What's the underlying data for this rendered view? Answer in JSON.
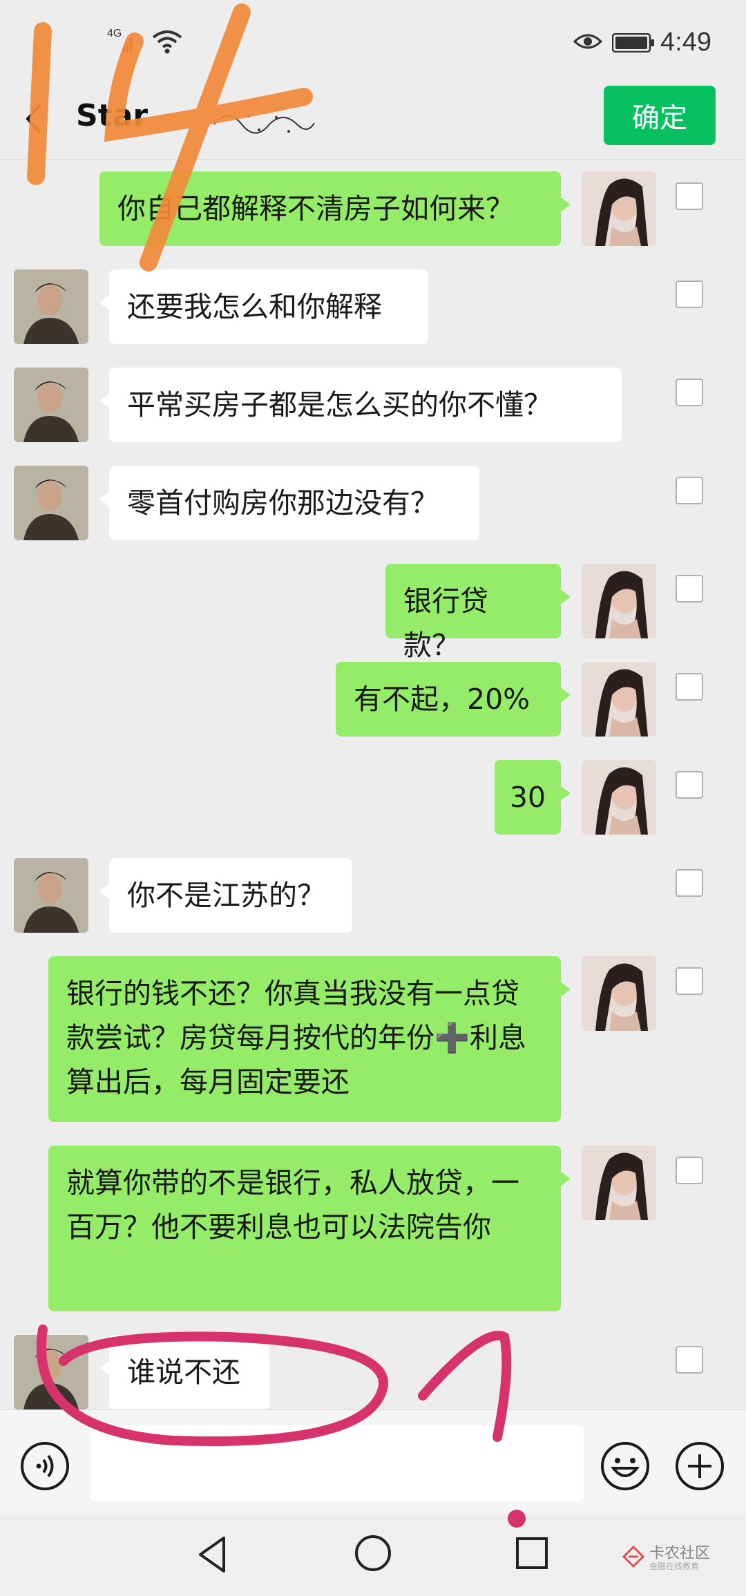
{
  "status_bar": {
    "network": "4G",
    "time": "4:49",
    "icons": [
      "signal-icon",
      "wifi-icon",
      "eye-icon",
      "battery-icon"
    ]
  },
  "header": {
    "title": "Star",
    "confirm_label": "确定",
    "back_icon": "chevron-left-icon"
  },
  "messages": [
    {
      "sender": "me",
      "text": "你自己都解释不清房子如何来？"
    },
    {
      "sender": "other",
      "text": "还要我怎么和你解释"
    },
    {
      "sender": "other",
      "text": "平常买房子都是怎么买的你不懂？"
    },
    {
      "sender": "other",
      "text": "零首付购房你那边没有？"
    },
    {
      "sender": "me",
      "text": "银行贷款？"
    },
    {
      "sender": "me",
      "text": "有不起，20%"
    },
    {
      "sender": "me",
      "text": "30"
    },
    {
      "sender": "other",
      "text": "你不是江苏的？"
    },
    {
      "sender": "me",
      "text": "银行的钱不还？你真当我没有一点贷款尝试？房贷每月按代的年份➕利息算出后，每月固定要还"
    },
    {
      "sender": "me",
      "text": "就算你带的不是银行，私人放贷，一百万？他不要利息也可以法院告你"
    },
    {
      "sender": "other",
      "text": "谁说不还"
    }
  ],
  "input_bar": {
    "value": "",
    "icons": [
      "voice-icon",
      "emoji-icon",
      "plus-icon"
    ]
  },
  "nav_bar": {
    "icons": [
      "nav-back-icon",
      "nav-home-icon",
      "nav-recent-icon"
    ]
  },
  "watermark": {
    "title": "卡农社区",
    "subtitle": "金融在线教育"
  },
  "annotations": {
    "number": "14",
    "colors": {
      "orange": "#f28a3a",
      "pink": "#d6336c"
    }
  },
  "colors": {
    "my_bubble": "#95ec69",
    "their_bubble": "#ffffff",
    "accent": "#07c160",
    "background": "#ededed"
  }
}
